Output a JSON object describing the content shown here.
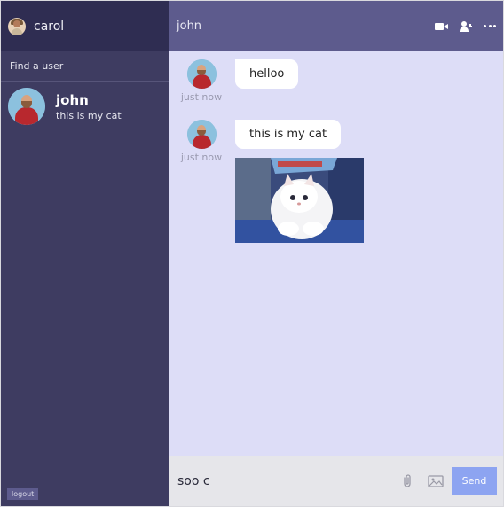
{
  "sidebar": {
    "current_user": "carol",
    "search_placeholder": "Find a user",
    "chats": [
      {
        "name": "john",
        "last_message": "this is my cat"
      }
    ],
    "logout_label": "logout"
  },
  "chat": {
    "title": "john",
    "header_icons": [
      "video-camera-icon",
      "add-user-icon",
      "more-icon"
    ],
    "messages": [
      {
        "text": "helloo",
        "time": "just now"
      },
      {
        "text": "this is my cat",
        "time": "just now",
        "has_image": true
      }
    ]
  },
  "input": {
    "value": "soo c",
    "send_label": "Send"
  },
  "colors": {
    "sidebar_bg": "#3e3c61",
    "sidebar_top_bg": "#2f2d52",
    "header_bg": "#5d5b8d",
    "messages_bg": "#ddddf7",
    "send_button": "#8da4f1"
  }
}
